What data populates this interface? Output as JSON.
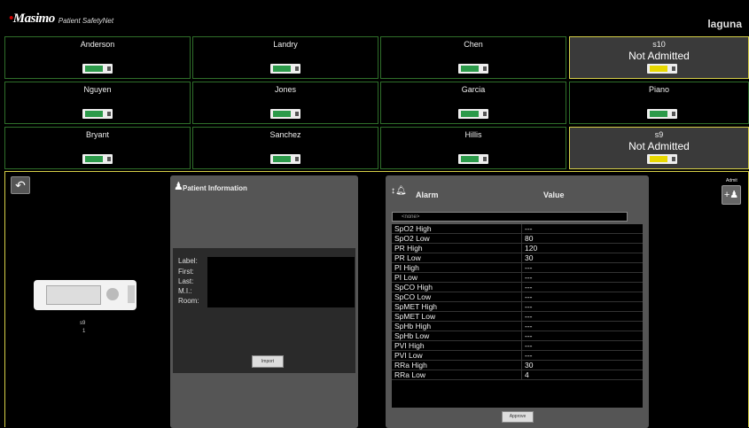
{
  "app": {
    "logo": "Masimo",
    "subtitle": "Patient SafetyNet",
    "host": "laguna"
  },
  "tiles": [
    {
      "name": "Anderson",
      "status": "",
      "device": "green"
    },
    {
      "name": "Landry",
      "status": "",
      "device": "green"
    },
    {
      "name": "Chen",
      "status": "",
      "device": "green"
    },
    {
      "name": "s10",
      "status": "Not Admitted",
      "device": "yellow"
    },
    {
      "name": "Nguyen",
      "status": "",
      "device": "green"
    },
    {
      "name": "Jones",
      "status": "",
      "device": "green"
    },
    {
      "name": "Garcia",
      "status": "",
      "device": "green"
    },
    {
      "name": "Piano",
      "status": "",
      "device": "green"
    },
    {
      "name": "Bryant",
      "status": "",
      "device": "green"
    },
    {
      "name": "Sanchez",
      "status": "",
      "device": "green"
    },
    {
      "name": "Hillis",
      "status": "",
      "device": "green"
    },
    {
      "name": "s9",
      "status": "Not Admitted",
      "device": "yellow"
    }
  ],
  "detail": {
    "device_label": "s9",
    "device_sub": "1",
    "patient_info": {
      "title": "Patient Information",
      "fields": [
        {
          "label": "Label:",
          "value": ""
        },
        {
          "label": "First:",
          "value": ""
        },
        {
          "label": "Last:",
          "value": ""
        },
        {
          "label": "M.I.:",
          "value": ""
        },
        {
          "label": "Room:",
          "value": ""
        }
      ],
      "import_label": "Import"
    },
    "alarms": {
      "title": "Alarm",
      "value_header": "Value",
      "select_value": "<none>",
      "rows": [
        {
          "name": "SpO2 High",
          "value": "---"
        },
        {
          "name": "SpO2 Low",
          "value": "80"
        },
        {
          "name": "PR High",
          "value": "120"
        },
        {
          "name": "PR Low",
          "value": "30"
        },
        {
          "name": "PI High",
          "value": "---"
        },
        {
          "name": "PI Low",
          "value": "---"
        },
        {
          "name": "SpCO High",
          "value": "---"
        },
        {
          "name": "SpCO Low",
          "value": "---"
        },
        {
          "name": "SpMET High",
          "value": "---"
        },
        {
          "name": "SpMET Low",
          "value": "---"
        },
        {
          "name": "SpHb High",
          "value": "---"
        },
        {
          "name": "SpHb Low",
          "value": "---"
        },
        {
          "name": "PVI High",
          "value": "---"
        },
        {
          "name": "PVI Low",
          "value": "---"
        },
        {
          "name": "RRa High",
          "value": "30"
        },
        {
          "name": "RRa Low",
          "value": "4"
        }
      ],
      "approve_label": "Approve"
    },
    "admit_label": "Admit"
  }
}
